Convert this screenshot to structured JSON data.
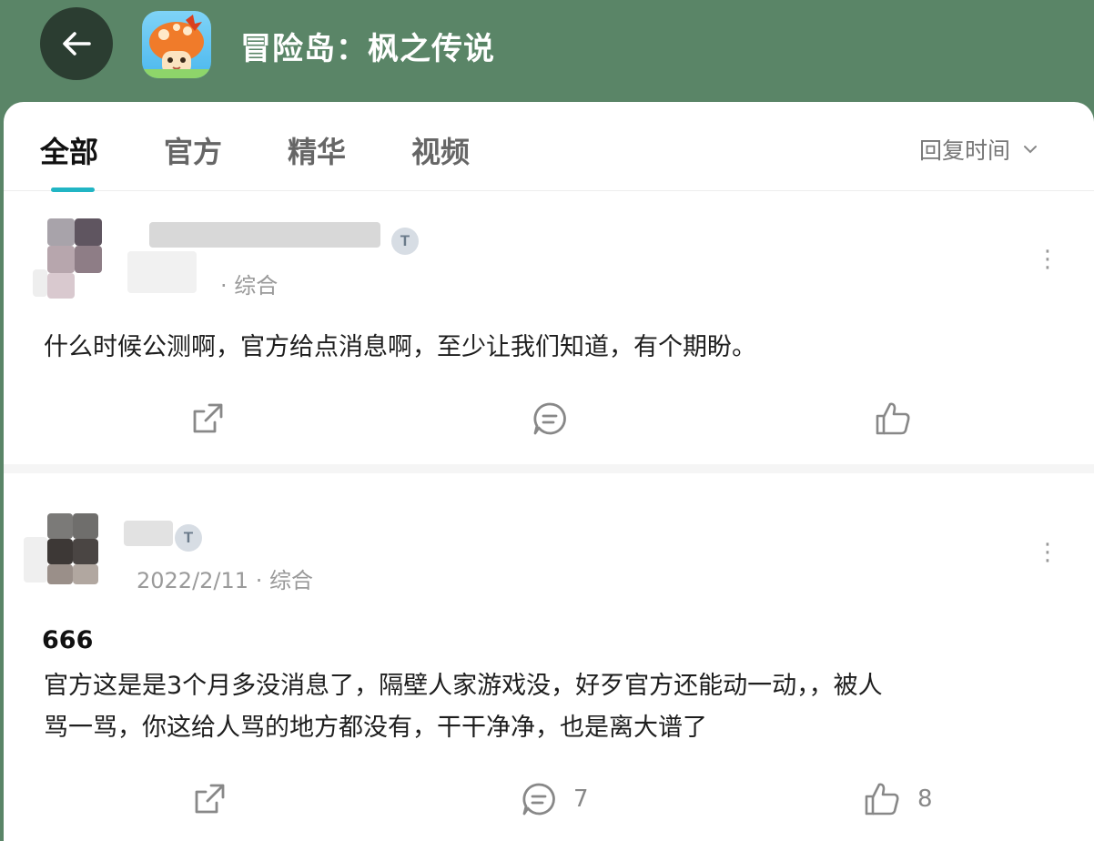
{
  "header": {
    "back_icon": "arrow-left-icon",
    "app_icon": "maplestory-app-icon",
    "title": "冒险岛：枫之传说"
  },
  "tabs": [
    {
      "label": "全部",
      "active": true
    },
    {
      "label": "官方",
      "active": false
    },
    {
      "label": "精华",
      "active": false
    },
    {
      "label": "视频",
      "active": false
    }
  ],
  "sort": {
    "label": "回复时间",
    "icon": "chevron-down-icon"
  },
  "posts": [
    {
      "meta": "· 综合",
      "body": "什么时候公测啊，官方给点消息啊，至少让我们知道，有个期盼。",
      "comment_count": "",
      "like_count": ""
    },
    {
      "meta": "2022/2/11 · 综合",
      "title": "666",
      "body_line1": "官方这是是3个月多没消息了，隔壁人家游戏没，好歹官方还能动一动，，被人",
      "body_line2": "骂一骂，你这给人骂的地方都没有，干干净净，也是离大谱了",
      "comment_count": "7",
      "like_count": "8"
    }
  ],
  "colors": {
    "header_bg": "#5a8567",
    "tab_accent": "#21b5c4"
  }
}
